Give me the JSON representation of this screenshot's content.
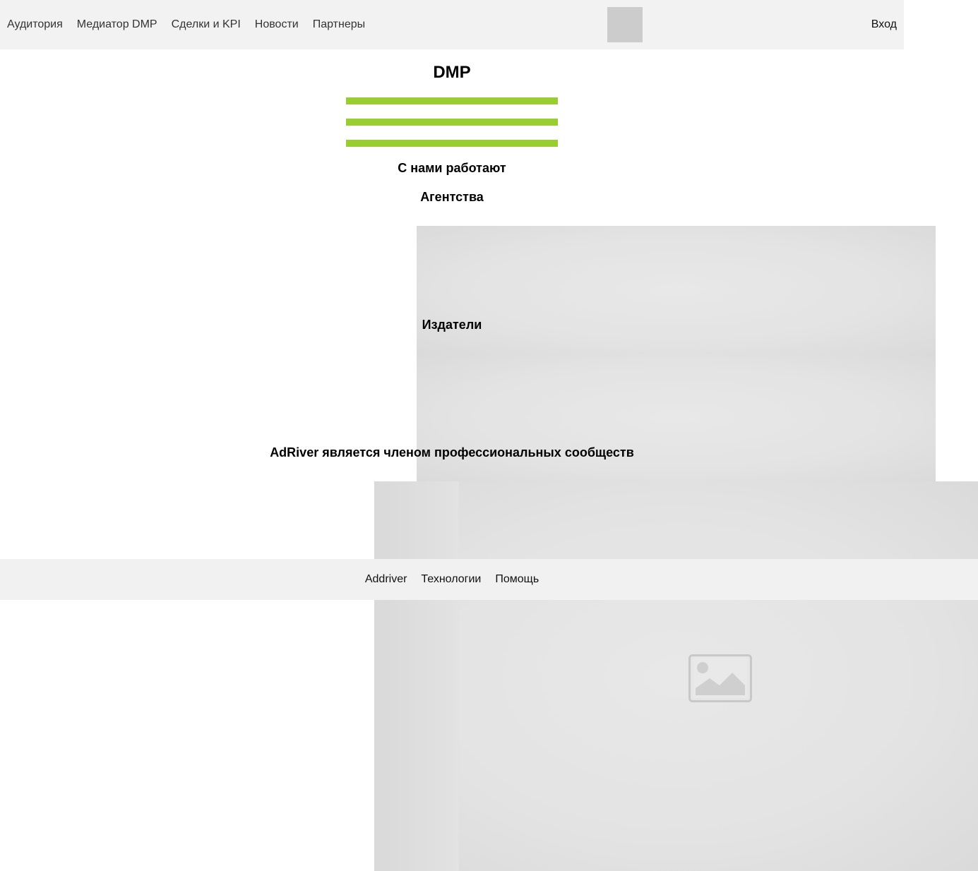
{
  "header": {
    "nav": [
      {
        "label": "Аудитория"
      },
      {
        "label": "Медиатор DMP"
      },
      {
        "label": "Сделки и KPI"
      },
      {
        "label": "Новости"
      },
      {
        "label": "Партнеры"
      }
    ],
    "login_label": "Вход"
  },
  "main": {
    "title": "DMP",
    "works_with_heading": "С нами работают",
    "agencies_heading": "Агентства",
    "publishers_heading": "Издатели",
    "communities_heading": "AdRiver является членом профессиональных сообществ"
  },
  "footer": {
    "links": [
      {
        "label": "Addriver"
      },
      {
        "label": "Технологии"
      },
      {
        "label": "Помощь"
      }
    ]
  },
  "colors": {
    "accent_bar": "#9acd32",
    "header_bg": "#f2f2f2",
    "footer_bg": "#f1f1f1",
    "placeholder_bg": "#e3e3e3"
  },
  "icons": {
    "broken_image": "image-placeholder-icon"
  }
}
